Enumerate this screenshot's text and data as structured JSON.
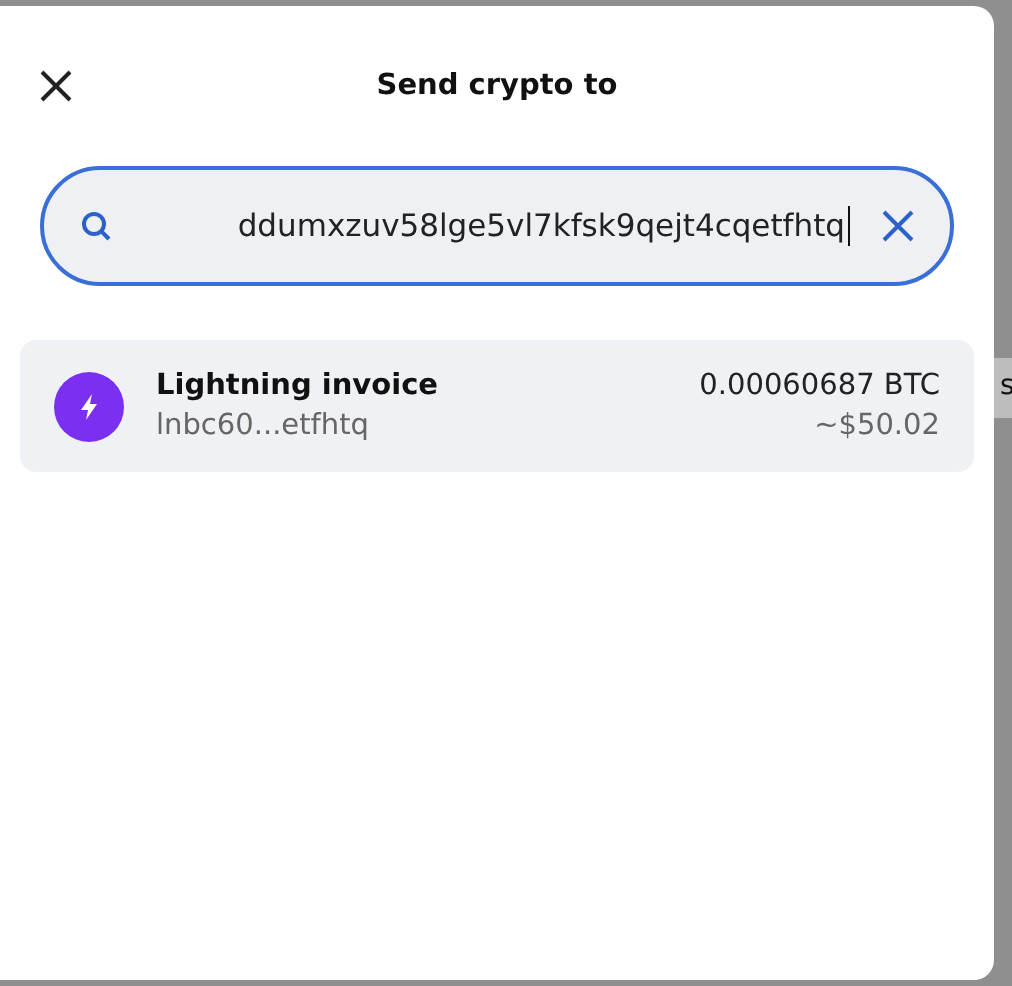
{
  "dialog": {
    "title": "Send crypto to"
  },
  "search": {
    "value": "ddumxzuv58lge5vl7kfsk9qejt4cqetfhtq",
    "focused": true
  },
  "results": [
    {
      "kind": "lightning",
      "title": "Lightning invoice",
      "subtitle": "lnbc60...etfhtq",
      "amount": "0.00060687 BTC",
      "fiat": "~$50.02",
      "hovered": true
    }
  ],
  "backdrop": {
    "text": "s"
  }
}
